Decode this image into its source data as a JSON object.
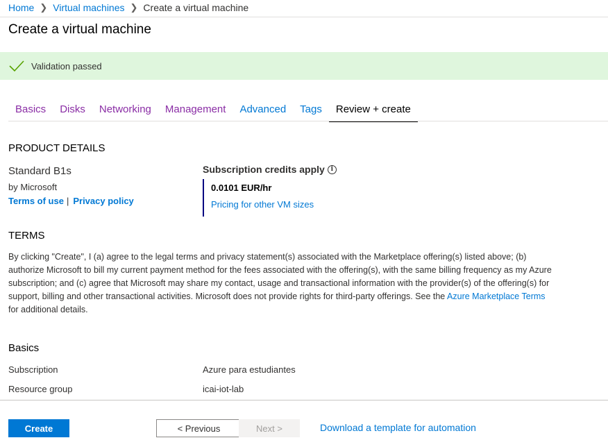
{
  "breadcrumb": {
    "items": [
      "Home",
      "Virtual machines"
    ],
    "current": "Create a virtual machine"
  },
  "page_title": "Create a virtual machine",
  "validation": {
    "message": "Validation passed",
    "color": "#dff6dd",
    "icon": "checkmark-icon"
  },
  "tabs": [
    "Basics",
    "Disks",
    "Networking",
    "Management",
    "Advanced",
    "Tags",
    "Review + create"
  ],
  "product": {
    "header": "PRODUCT DETAILS",
    "name": "Standard B1s",
    "publisher": "by Microsoft",
    "terms_link": "Terms of use",
    "privacy_link": "Privacy policy",
    "separator": "|",
    "credits_label": "Subscription credits apply",
    "info_icon": "i",
    "price": "0.0101 EUR/hr",
    "pricing_link": "Pricing for other VM sizes"
  },
  "terms": {
    "header": "TERMS",
    "text_before": "By clicking \"Create\", I (a) agree to the legal terms and privacy statement(s) associated with the Marketplace offering(s) listed above; (b) authorize Microsoft to bill my current payment method for the fees associated with the offering(s), with the same billing frequency as my Azure subscription; and (c) agree that Microsoft may share my contact, usage and transactional information with the provider(s) of the offering(s) for support, billing and other transactional activities. Microsoft does not provide rights for third-party offerings. See the ",
    "link": "Azure Marketplace Terms",
    "text_after": " for additional details."
  },
  "basics": {
    "header": "Basics",
    "rows": [
      {
        "label": "Subscription",
        "value": "Azure para estudiantes"
      },
      {
        "label": "Resource group",
        "value": "icai-iot-lab"
      }
    ]
  },
  "footer": {
    "create_label": "Create",
    "previous_label": "< Previous",
    "next_label": "Next >",
    "download_link": "Download a template for automation"
  },
  "colors": {
    "accent": "#0078d4",
    "visited_tab": "#8a2da5",
    "success": "#dff6dd",
    "price_border": "#000080"
  }
}
